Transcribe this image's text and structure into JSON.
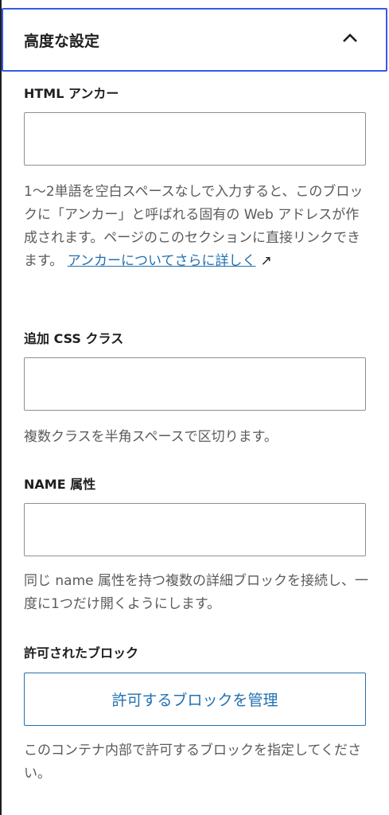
{
  "panel": {
    "title": "高度な設定"
  },
  "anchor": {
    "label": "HTML アンカー",
    "value": "",
    "help_text": "1〜2単語を空白スペースなしで入力すると、このブロックに「アンカー」と呼ばれる固有の Web アドレスが作成されます。ページのこのセクションに直接リンクできます。",
    "help_link": "アンカーについてさらに詳しく",
    "external_icon": "↗"
  },
  "css_class": {
    "label": "追加 CSS クラス",
    "value": "",
    "help_text": "複数クラスを半角スペースで区切ります。"
  },
  "name_attr": {
    "label": "NAME 属性",
    "value": "",
    "help_text": "同じ name 属性を持つ複数の詳細ブロックを接続し、一度に1つだけ開くようにします。"
  },
  "allowed_blocks": {
    "label": "許可されたブロック",
    "button_label": "許可するブロックを管理",
    "help_text": "このコンテナ内部で許可するブロックを指定してください。"
  },
  "colors": {
    "accent": "#3858e9",
    "link": "#2271b1",
    "help_text": "#5b5b5b",
    "border": "#8c8f94"
  },
  "icons": {
    "collapse": "chevron-up-icon",
    "external": "external-link-icon"
  }
}
